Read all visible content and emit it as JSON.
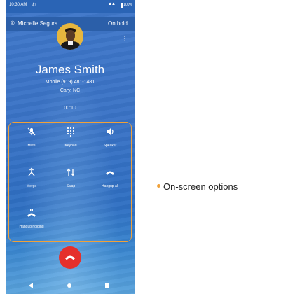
{
  "status_bar": {
    "time": "10:30 AM",
    "call_icon": "phone-icon",
    "signal": "4G",
    "battery": "100%"
  },
  "call_bar": {
    "name": "Michelle Segura",
    "state": "On hold",
    "icon": "phone-in-call-icon"
  },
  "caller": {
    "name": "James Smith",
    "number": "Mobile (919) 481-1481",
    "location": "Cary, NC",
    "timer": "00:10"
  },
  "options": {
    "items": [
      {
        "label": "Mute",
        "icon": "mic-off-icon"
      },
      {
        "label": "Keypad",
        "icon": "keypad-icon"
      },
      {
        "label": "Speaker",
        "icon": "speaker-icon"
      },
      {
        "label": "Merge",
        "icon": "merge-icon"
      },
      {
        "label": "Swap",
        "icon": "swap-icon"
      },
      {
        "label": "Hangup all",
        "icon": "hangup-all-icon"
      },
      {
        "label": "Hangup holding",
        "icon": "hangup-holding-icon"
      }
    ]
  },
  "callout": {
    "text": "On-screen options",
    "color": "#f0a13a"
  },
  "colors": {
    "end_call": "#e5302c",
    "accent": "#f0a13a",
    "background": "#3a73c6"
  }
}
